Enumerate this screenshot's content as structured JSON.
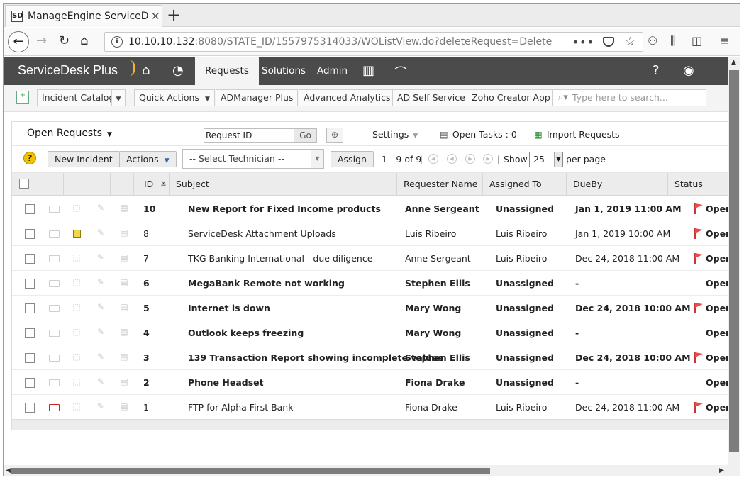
{
  "browser": {
    "tab_title": "ManageEngine ServiceDesk",
    "url_host": "10.10.10.132",
    "url_rest": ":8080/STATE_ID/1557975314033/WOListView.do?deleteRequest=Delete"
  },
  "header": {
    "logo": "ServiceDesk Plus",
    "menu": [
      "Requests",
      "Solutions",
      "Admin"
    ]
  },
  "toolbar": {
    "buttons": [
      "Incident Catalog",
      "Quick Actions",
      "ADManager Plus",
      "Advanced Analytics",
      "AD Self Service",
      "Zoho Creator App"
    ],
    "search_placeholder": "Type here to search..."
  },
  "listbar": {
    "view": "Open Requests",
    "request_id_label": "Request ID",
    "go": "Go",
    "settings": "Settings",
    "open_tasks": "Open Tasks : 0",
    "import_requests": "Import Requests"
  },
  "actions": {
    "new_incident": "New Incident",
    "actions": "Actions",
    "technician_placeholder": "-- Select Technician --",
    "assign": "Assign",
    "pager": "1 - 9 of 9",
    "show": "Show",
    "per_page_value": "25",
    "per_page": "per page"
  },
  "table": {
    "columns": [
      "ID",
      "Subject",
      "Requester Name",
      "Assigned To",
      "DueBy",
      "Status"
    ],
    "rows": [
      {
        "id": "10",
        "subject": "New Report for Fixed Income products",
        "requester": "Anne Sergeant",
        "assigned": "Unassigned",
        "dueby": "Jan 1, 2019 11:00 AM",
        "status": "Open",
        "bold": true,
        "flag": true,
        "note": false,
        "red_mail": false
      },
      {
        "id": "8",
        "subject": "ServiceDesk Attachment Uploads",
        "requester": "Luis Ribeiro",
        "assigned": "Luis Ribeiro",
        "dueby": "Jan 1, 2019 10:00 AM",
        "status": "Open",
        "bold": false,
        "flag": true,
        "note": true,
        "red_mail": false
      },
      {
        "id": "7",
        "subject": "TKG Banking International - due diligence",
        "requester": "Anne Sergeant",
        "assigned": "Luis Ribeiro",
        "dueby": "Dec 24, 2018 11:00 AM",
        "status": "Open",
        "bold": false,
        "flag": true,
        "note": false,
        "red_mail": false
      },
      {
        "id": "6",
        "subject": "MegaBank Remote not working",
        "requester": "Stephen Ellis",
        "assigned": "Unassigned",
        "dueby": "-",
        "status": "Open",
        "bold": true,
        "flag": false,
        "note": false,
        "red_mail": false
      },
      {
        "id": "5",
        "subject": "Internet is down",
        "requester": "Mary Wong",
        "assigned": "Unassigned",
        "dueby": "Dec 24, 2018 10:00 AM",
        "status": "Open",
        "bold": true,
        "flag": true,
        "note": false,
        "red_mail": false
      },
      {
        "id": "4",
        "subject": "Outlook keeps freezing",
        "requester": "Mary Wong",
        "assigned": "Unassigned",
        "dueby": "-",
        "status": "Open",
        "bold": true,
        "flag": false,
        "note": false,
        "red_mail": false
      },
      {
        "id": "3",
        "subject": "139 Transaction Report showing incomplete values",
        "requester": "Stephen Ellis",
        "assigned": "Unassigned",
        "dueby": "Dec 24, 2018 10:00 AM",
        "status": "Open",
        "bold": true,
        "flag": true,
        "note": false,
        "red_mail": false
      },
      {
        "id": "2",
        "subject": "Phone Headset",
        "requester": "Fiona Drake",
        "assigned": "Unassigned",
        "dueby": "-",
        "status": "Open",
        "bold": true,
        "flag": false,
        "note": false,
        "red_mail": false
      },
      {
        "id": "1",
        "subject": "FTP for Alpha First Bank",
        "requester": "Fiona Drake",
        "assigned": "Luis Ribeiro",
        "dueby": "Dec 24, 2018 11:00 AM",
        "status": "Open",
        "bold": false,
        "flag": true,
        "note": false,
        "red_mail": true
      }
    ]
  },
  "colors": {
    "header_bg": "#4b4b4b",
    "flag": "#e94b4b",
    "accent": "#f0b429"
  }
}
